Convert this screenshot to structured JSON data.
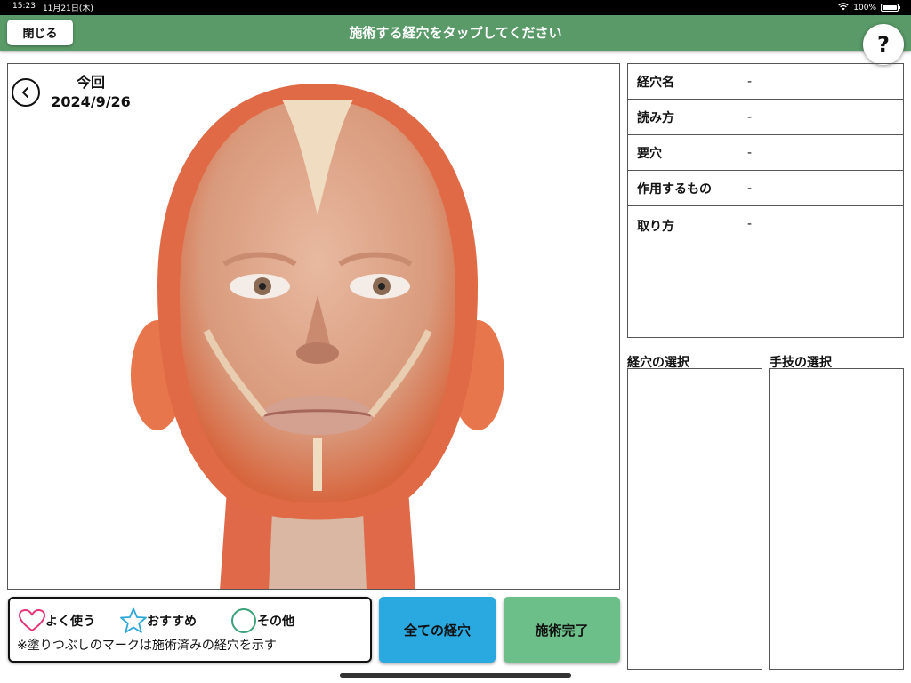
{
  "status_bar": {
    "time": "15:23",
    "date": "11月21日(木)",
    "battery": "100%",
    "battery_level": 1.0
  },
  "header": {
    "title": "施術する経穴をタップしてください",
    "close_label": "閉じる",
    "help_label": "?"
  },
  "visit": {
    "label": "今回",
    "date": "2024/9/26"
  },
  "info": {
    "rows": [
      {
        "label": "経穴名",
        "value": "-"
      },
      {
        "label": "読み方",
        "value": "-"
      },
      {
        "label": "要穴",
        "value": "-"
      },
      {
        "label": "作用するもの",
        "value": "-"
      },
      {
        "label": "取り方",
        "value": "-"
      }
    ]
  },
  "selection": {
    "acupoint_label": "経穴の選択",
    "technique_label": "手技の選択"
  },
  "legend": {
    "items": [
      {
        "icon": "heart-icon",
        "label": "よく使う",
        "color": "#e5337a"
      },
      {
        "icon": "star-icon",
        "label": "おすすめ",
        "color": "#2ca7d8"
      },
      {
        "icon": "circle-icon",
        "label": "その他",
        "color": "#3aa27a"
      }
    ],
    "note": "※塗りつぶしのマークは施術済みの経穴を示す"
  },
  "buttons": {
    "all_acupoints": "全ての経穴",
    "all_acupoints_color": "#2aa8e0",
    "complete": "施術完了",
    "complete_color": "#6dbf8a"
  },
  "colors": {
    "header": "#5a9a68"
  }
}
